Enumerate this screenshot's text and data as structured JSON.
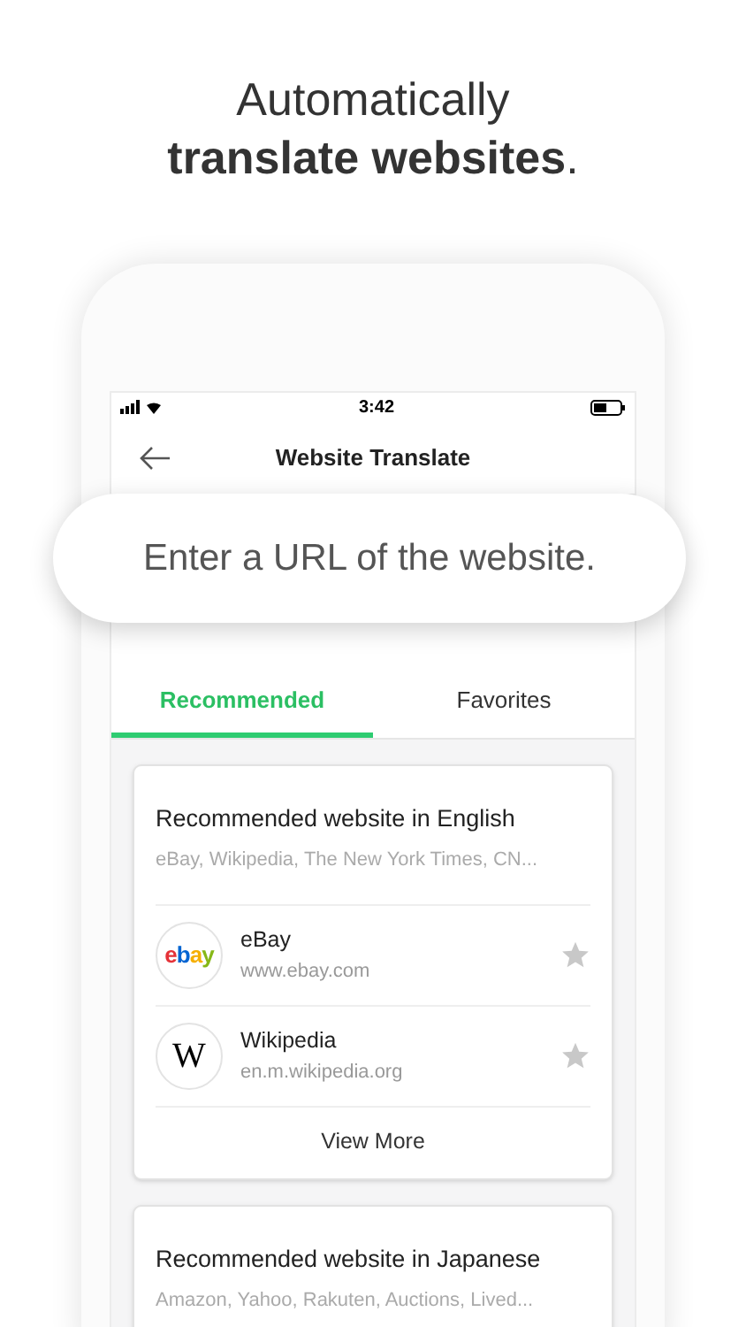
{
  "headline": {
    "line_1": "Automatically",
    "line_2": "translate websites",
    "line_2_end": "."
  },
  "status_bar": {
    "time": "3:42"
  },
  "nav": {
    "title": "Website Translate"
  },
  "callout": {
    "text": "Enter a URL of the website."
  },
  "tabs": [
    {
      "label": "Recommended",
      "selected": true
    },
    {
      "label": "Favorites",
      "selected": false
    }
  ],
  "cards": [
    {
      "title": "Recommended website in English",
      "subtitle": "eBay, Wikipedia, The New York Times, CN...",
      "sites": [
        {
          "logo": "ebay",
          "kind": "ebay",
          "name": "eBay",
          "url": "www.ebay.com",
          "favorite": false
        },
        {
          "logo": "W",
          "kind": "serif",
          "name": "Wikipedia",
          "url": "en.m.wikipedia.org",
          "favorite": false
        }
      ],
      "more": "View More"
    },
    {
      "title": "Recommended website in Japanese",
      "subtitle": "Amazon, Yahoo, Rakuten, Auctions, Lived..."
    }
  ]
}
